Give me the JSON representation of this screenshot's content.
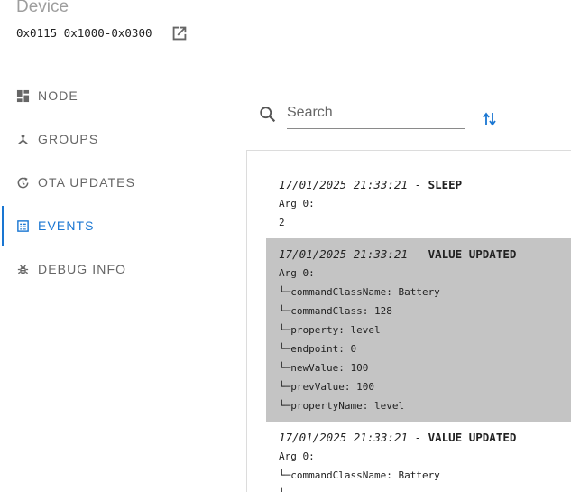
{
  "header": {
    "title": "Device",
    "device_id": "0x0115 0x1000-0x0300"
  },
  "nav": {
    "items": [
      {
        "label": "NODE",
        "icon": "dashboard-icon"
      },
      {
        "label": "GROUPS",
        "icon": "groups-icon"
      },
      {
        "label": "OTA UPDATES",
        "icon": "update-icon"
      },
      {
        "label": "EVENTS",
        "icon": "events-list-icon",
        "active": true
      },
      {
        "label": "DEBUG INFO",
        "icon": "bug-icon"
      }
    ]
  },
  "search": {
    "placeholder": "Search",
    "value": ""
  },
  "colors": {
    "accent": "#1976d2",
    "highlight_bg": "#c4c4c4"
  },
  "events": [
    {
      "timestamp": "17/01/2025 21:33:21",
      "separator": " - ",
      "name": "SLEEP",
      "lines": [
        "Arg 0:",
        "2"
      ]
    },
    {
      "timestamp": "17/01/2025 21:33:21",
      "separator": " - ",
      "name": "VALUE UPDATED",
      "lines": [
        "Arg 0:",
        "└─commandClassName: Battery",
        "└─commandClass: 128",
        "└─property: level",
        "└─endpoint: 0",
        "└─newValue: 100",
        "└─prevValue: 100",
        "└─propertyName: level"
      ]
    },
    {
      "timestamp": "17/01/2025 21:33:21",
      "separator": " - ",
      "name": "VALUE UPDATED",
      "lines": [
        "Arg 0:",
        "└─commandClassName: Battery",
        "└"
      ]
    }
  ]
}
